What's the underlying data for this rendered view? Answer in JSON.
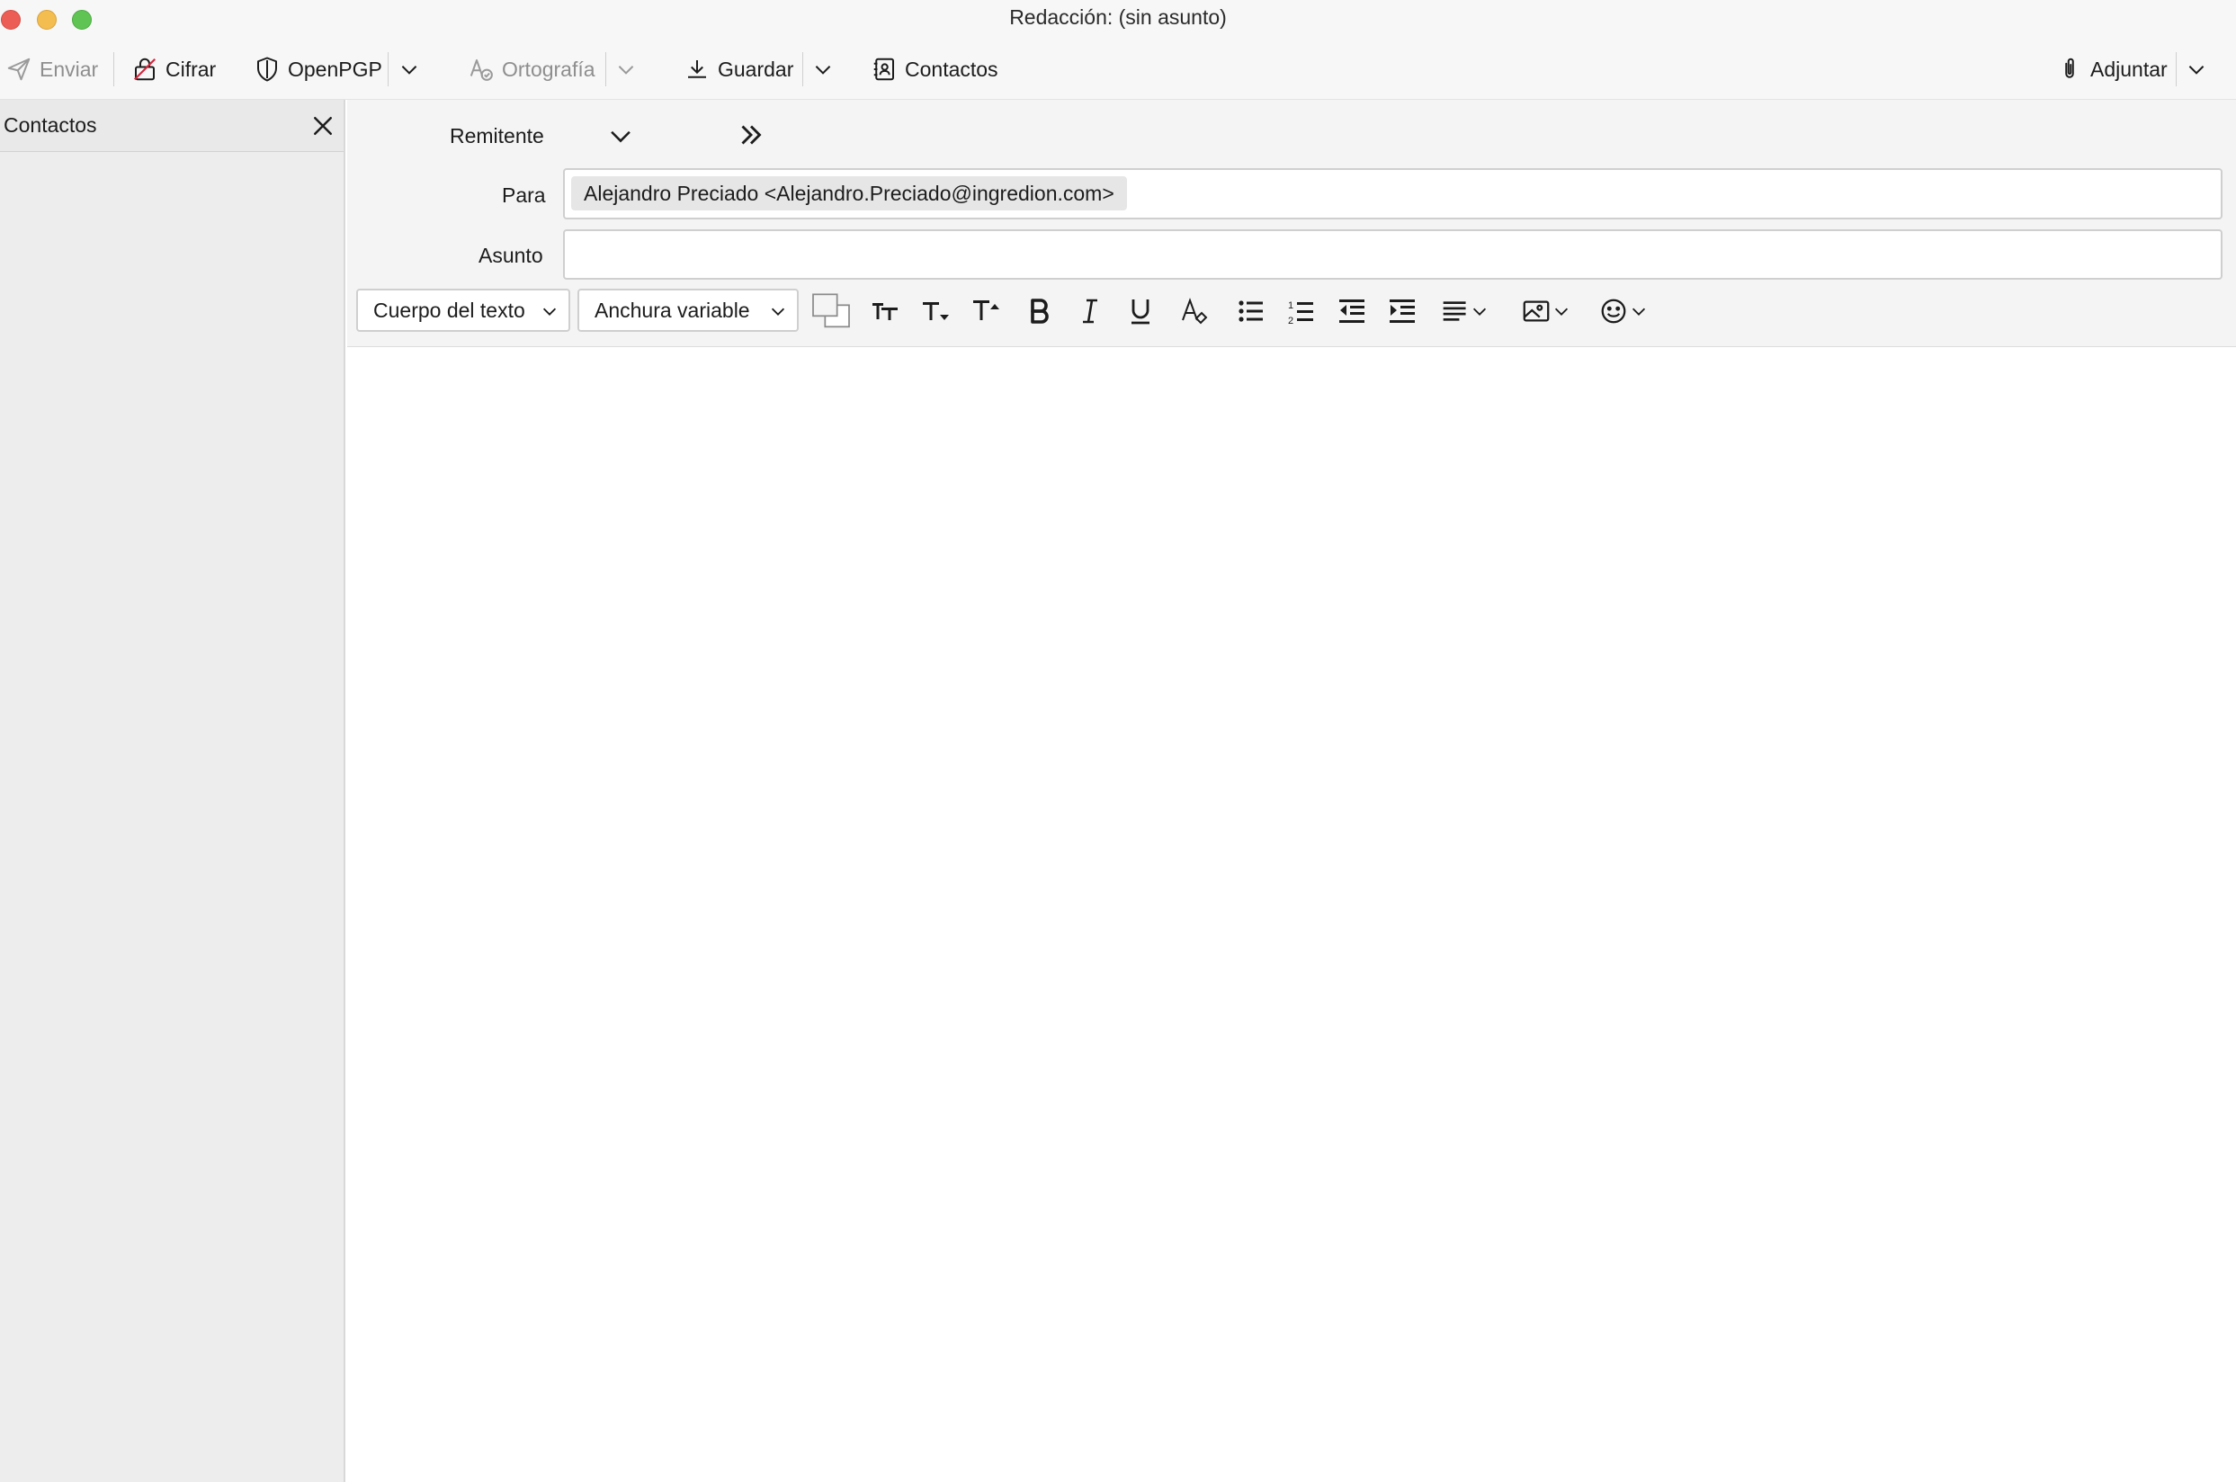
{
  "window": {
    "title": "Redacción: (sin asunto)"
  },
  "toolbar": {
    "send_label": "Enviar",
    "encrypt_label": "Cifrar",
    "openpgp_label": "OpenPGP",
    "spelling_label": "Ortografía",
    "save_label": "Guardar",
    "contacts_label": "Contactos",
    "attach_label": "Adjuntar"
  },
  "sidebar": {
    "title": "Contactos"
  },
  "header": {
    "from_label": "Remitente",
    "to_label": "Para",
    "recipient": "Alejandro Preciado <Alejandro.Preciado@ingredion.com>",
    "subject_label": "Asunto",
    "subject_value": ""
  },
  "format_toolbar": {
    "paragraph_format": "Cuerpo del texto",
    "font": "Anchura variable"
  },
  "colors": {
    "close": "#ec5e55",
    "minimize": "#f4bd4f",
    "maximize": "#60c454",
    "encrypt_slash": "#d7263d"
  }
}
